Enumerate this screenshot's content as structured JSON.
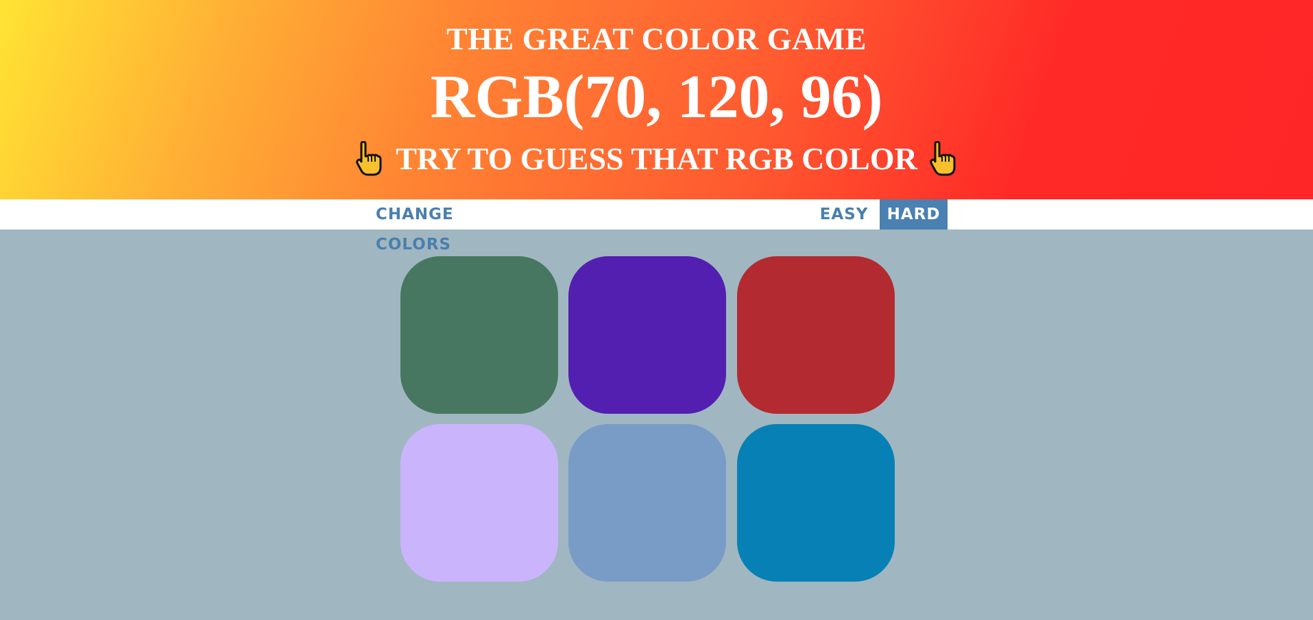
{
  "header": {
    "title": "THE GREAT COLOR GAME",
    "rgb_target": "RGB(70, 120, 96)",
    "prompt": "TRY TO GUESS THAT RGB COLOR",
    "prompt_icon": "pointing-hand-icon"
  },
  "controls": {
    "change_colors_label": "CHANGE COLORS",
    "easy_label": "EASY",
    "hard_label": "HARD",
    "selected_mode": "HARD"
  },
  "colors": {
    "background": "#a0b7c1",
    "accent": "#4a80b2",
    "header_gradient_start": "#ffe433",
    "header_gradient_end": "#ff2627"
  },
  "squares": [
    {
      "color": "#477760"
    },
    {
      "color": "#531fb1"
    },
    {
      "color": "#b32b30"
    },
    {
      "color": "#cab5fd"
    },
    {
      "color": "#799cc7"
    },
    {
      "color": "#0781b5"
    }
  ]
}
